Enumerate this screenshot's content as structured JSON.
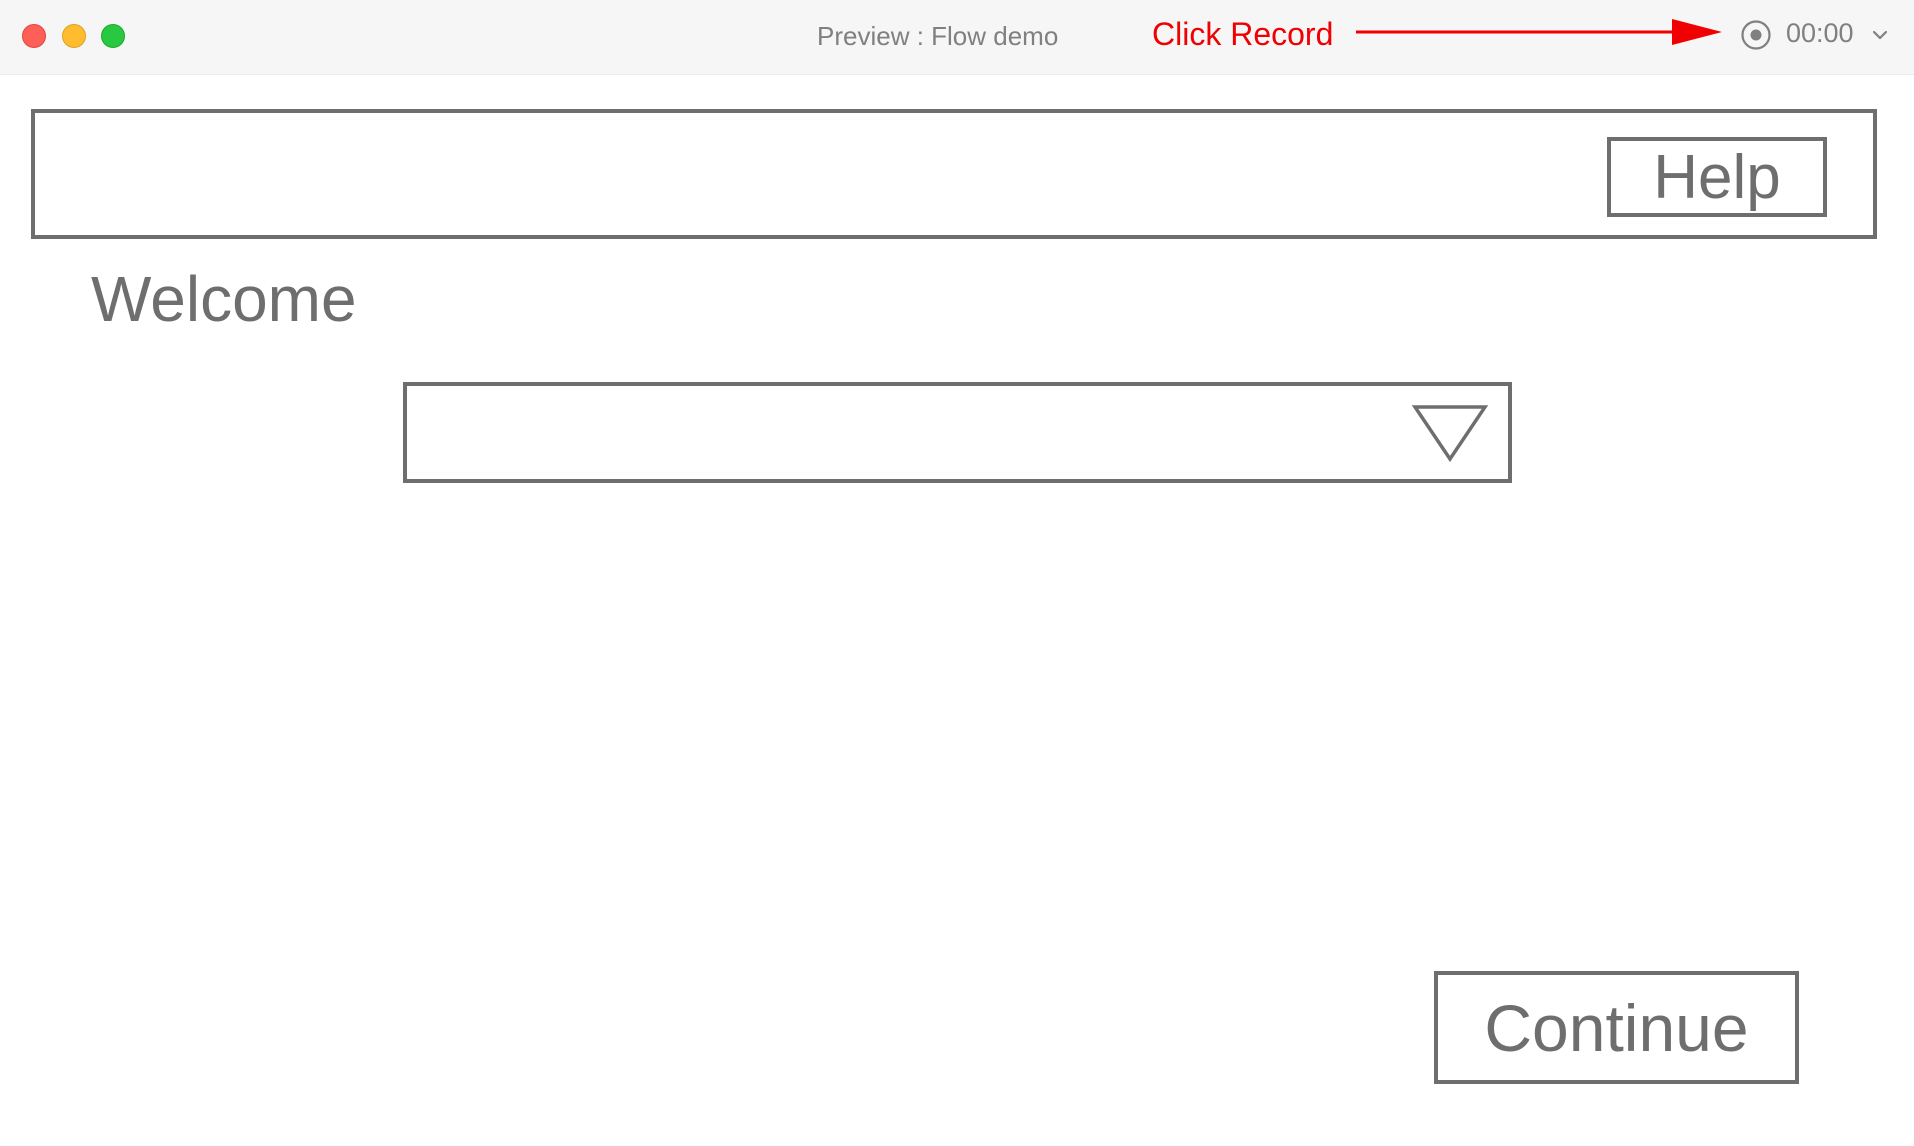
{
  "window": {
    "title": "Preview : Flow demo",
    "traffic_lights": [
      "close",
      "minimize",
      "zoom"
    ]
  },
  "recorder": {
    "annotation": "Click Record",
    "annotation_color": "#f00000",
    "timer": "00:00",
    "record_icon": "record-icon",
    "menu_icon": "chevron-down-icon"
  },
  "header": {
    "help_label": "Help"
  },
  "main": {
    "welcome": "Welcome",
    "dropdown": {
      "value": "",
      "icon": "triangle-down-icon"
    },
    "continue_label": "Continue"
  },
  "colors": {
    "wireframe": "#6e6e6e",
    "titlebar_bg": "#f6f6f6",
    "close": "#fe5f57",
    "minimize": "#febc2e",
    "zoom": "#28c840"
  }
}
